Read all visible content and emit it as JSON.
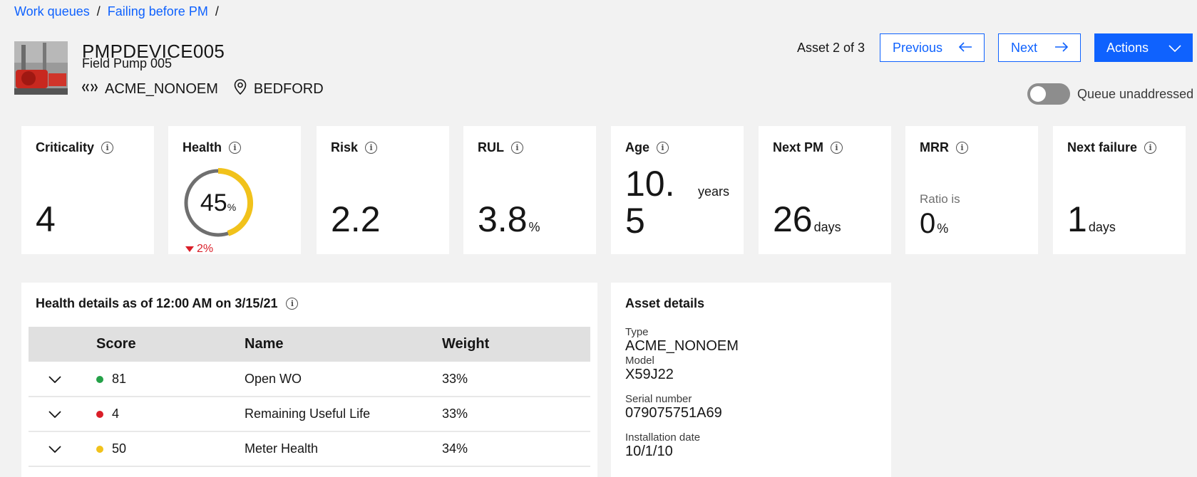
{
  "breadcrumb": {
    "items": [
      "Work queues",
      "Failing before PM"
    ],
    "separator": "/"
  },
  "asset": {
    "id": "PMPDEVICE005",
    "name": "Field Pump 005",
    "type_tag": "ACME_NONOEM",
    "location_tag": "BEDFORD",
    "thumbnail_icon": "pump-photo"
  },
  "navigation": {
    "counter": "Asset 2 of 3",
    "previous_label": "Previous",
    "next_label": "Next",
    "actions_label": "Actions"
  },
  "queue_toggle": {
    "label": "Queue unaddressed",
    "on": false
  },
  "kpis": {
    "criticality": {
      "label": "Criticality",
      "value": "4"
    },
    "health": {
      "label": "Health",
      "value": "45",
      "unit": "%",
      "percent": 45,
      "change": "2%",
      "change_direction": "down"
    },
    "risk": {
      "label": "Risk",
      "value": "2.2"
    },
    "rul": {
      "label": "RUL",
      "value": "3.8",
      "unit": "%"
    },
    "age": {
      "label": "Age",
      "value_line1": "10.",
      "value_line2": "5",
      "unit": "years"
    },
    "next_pm": {
      "label": "Next PM",
      "value": "26",
      "unit": "days"
    },
    "mrr": {
      "label": "MRR",
      "sub_label": "Ratio is",
      "value": "0",
      "unit": "%"
    },
    "next_failure": {
      "label": "Next failure",
      "value": "1",
      "unit": "days"
    }
  },
  "health_details": {
    "title": "Health details as of 12:00 AM on 3/15/21",
    "columns": [
      "Score",
      "Name",
      "Weight"
    ],
    "rows": [
      {
        "score": "81",
        "status_color": "#24a148",
        "name": "Open WO",
        "weight": "33%"
      },
      {
        "score": "4",
        "status_color": "#da1e28",
        "name": "Remaining Useful Life",
        "weight": "33%"
      },
      {
        "score": "50",
        "status_color": "#f1c21b",
        "name": "Meter Health",
        "weight": "34%"
      }
    ]
  },
  "asset_details": {
    "title": "Asset details",
    "fields": [
      {
        "label": "Type",
        "value": "ACME_NONOEM"
      },
      {
        "label": "Model",
        "value": "X59J22"
      },
      {
        "label": "Serial number",
        "value": "079075751A69"
      },
      {
        "label": "Installation date",
        "value": "10/1/10"
      }
    ]
  },
  "colors": {
    "accent": "#0f62fe",
    "health_gauge": "#f1c21b",
    "health_gauge_track": "#6f6f6f",
    "trend_down": "#da1e28"
  }
}
